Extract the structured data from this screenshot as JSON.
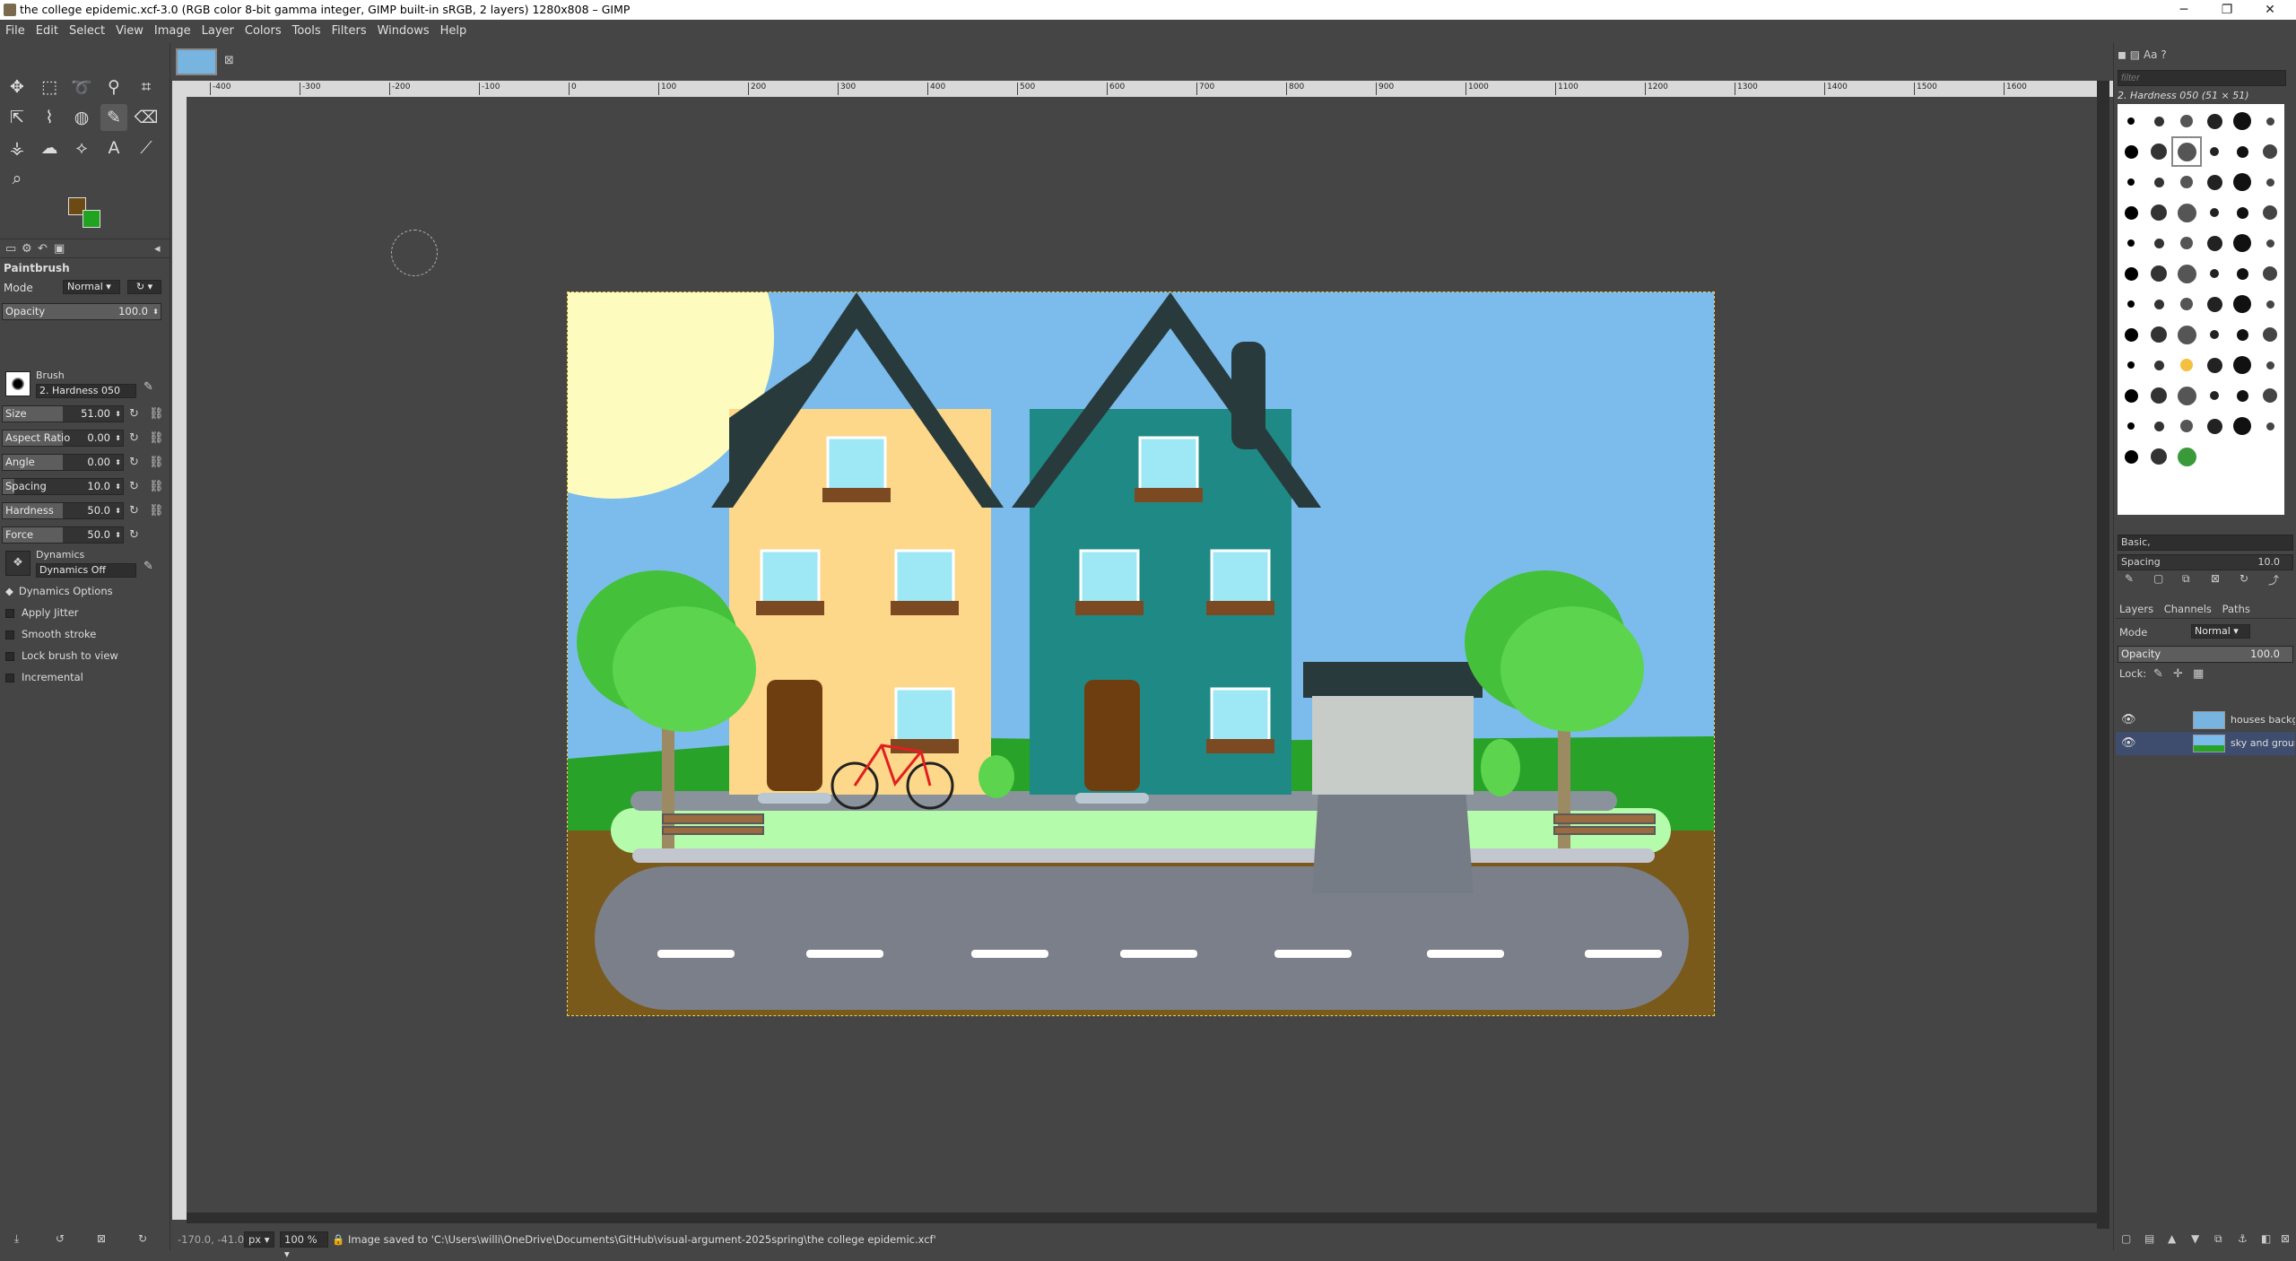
{
  "window": {
    "title": "the college epidemic.xcf-3.0 (RGB color 8-bit gamma integer, GIMP built-in sRGB, 2 layers) 1280x808 – GIMP",
    "controls": [
      "─",
      "❐",
      "✕"
    ]
  },
  "menu": [
    "File",
    "Edit",
    "Select",
    "View",
    "Image",
    "Layer",
    "Colors",
    "Tools",
    "Filters",
    "Windows",
    "Help"
  ],
  "colors": {
    "foreground": "#6b4a14",
    "background": "#21a321"
  },
  "tool_options": {
    "tool_name": "Paintbrush",
    "mode_label": "Mode",
    "mode_value": "Normal",
    "opacity": {
      "label": "Opacity",
      "value": "100.0",
      "fraction": 1.0
    },
    "brush_label": "Brush",
    "brush_value": "2. Hardness 050",
    "size": {
      "label": "Size",
      "value": "51.00",
      "fraction": 0.5
    },
    "aspect": {
      "label": "Aspect Ratio",
      "value": "0.00",
      "fraction": 0.5
    },
    "angle": {
      "label": "Angle",
      "value": "0.00",
      "fraction": 0.5
    },
    "spacing": {
      "label": "Spacing",
      "value": "10.0",
      "fraction": 0.1
    },
    "hardness": {
      "label": "Hardness",
      "value": "50.0",
      "fraction": 0.5
    },
    "force": {
      "label": "Force",
      "value": "50.0",
      "fraction": 0.5
    },
    "dynamics_label": "Dynamics",
    "dynamics_value": "Dynamics Off",
    "dynamics_options": "Dynamics Options",
    "apply_jitter": "Apply Jitter",
    "smooth_stroke": "Smooth stroke",
    "lock_brush": "Lock brush to view",
    "incremental": "Incremental"
  },
  "ruler_ticks": [
    "-400",
    "-300",
    "-200",
    "-100",
    "0",
    "100",
    "200",
    "300",
    "400",
    "500",
    "600",
    "700",
    "800",
    "900",
    "1000",
    "1100",
    "1200",
    "1300",
    "1400",
    "1500",
    "1600"
  ],
  "status": {
    "coords": "-170.0, -41.0",
    "unit": "px",
    "zoom": "100 %",
    "message": "Image saved to 'C:\\Users\\willi\\OneDrive\\Documents\\GitHub\\visual-argument-2025spring\\the college epidemic.xcf'"
  },
  "brushes_panel": {
    "filter_placeholder": "filter",
    "selected": "2. Hardness 050 (51 × 51)",
    "preset": "Basic,",
    "spacing_label": "Spacing",
    "spacing_value": "10.0"
  },
  "layers_panel": {
    "tabs": [
      "Layers",
      "Channels",
      "Paths"
    ],
    "mode_label": "Mode",
    "mode_value": "Normal",
    "opacity_label": "Opacity",
    "opacity_value": "100.0",
    "lock_label": "Lock:",
    "layers": [
      {
        "name": "houses backgrou",
        "selected": false
      },
      {
        "name": "sky and ground",
        "selected": true
      }
    ]
  }
}
